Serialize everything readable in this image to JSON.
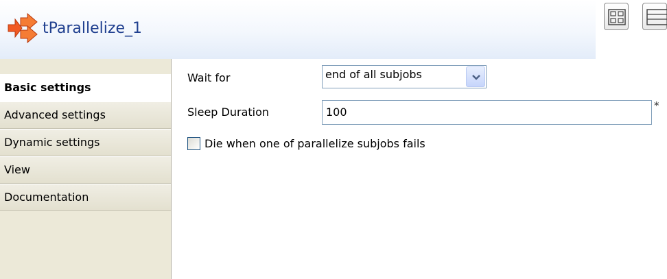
{
  "header": {
    "title": "tParallelize_1",
    "icon": "component-arrows-icon",
    "accent_color": "#f15a24"
  },
  "sidebar": {
    "tabs": [
      {
        "label": "Basic settings",
        "active": true
      },
      {
        "label": "Advanced settings",
        "active": false
      },
      {
        "label": "Dynamic settings",
        "active": false
      },
      {
        "label": "View",
        "active": false
      },
      {
        "label": "Documentation",
        "active": false
      }
    ]
  },
  "form": {
    "wait_for": {
      "label": "Wait for",
      "value": "end of all subjobs"
    },
    "sleep_duration": {
      "label": "Sleep Duration",
      "value": "100",
      "required_marker": "*"
    },
    "die_on_fail": {
      "label": "Die when one of parallelize subjobs fails",
      "checked": false
    }
  },
  "toolbar": {
    "buttons": [
      "grid-layout-icon",
      "table-layout-icon"
    ]
  }
}
